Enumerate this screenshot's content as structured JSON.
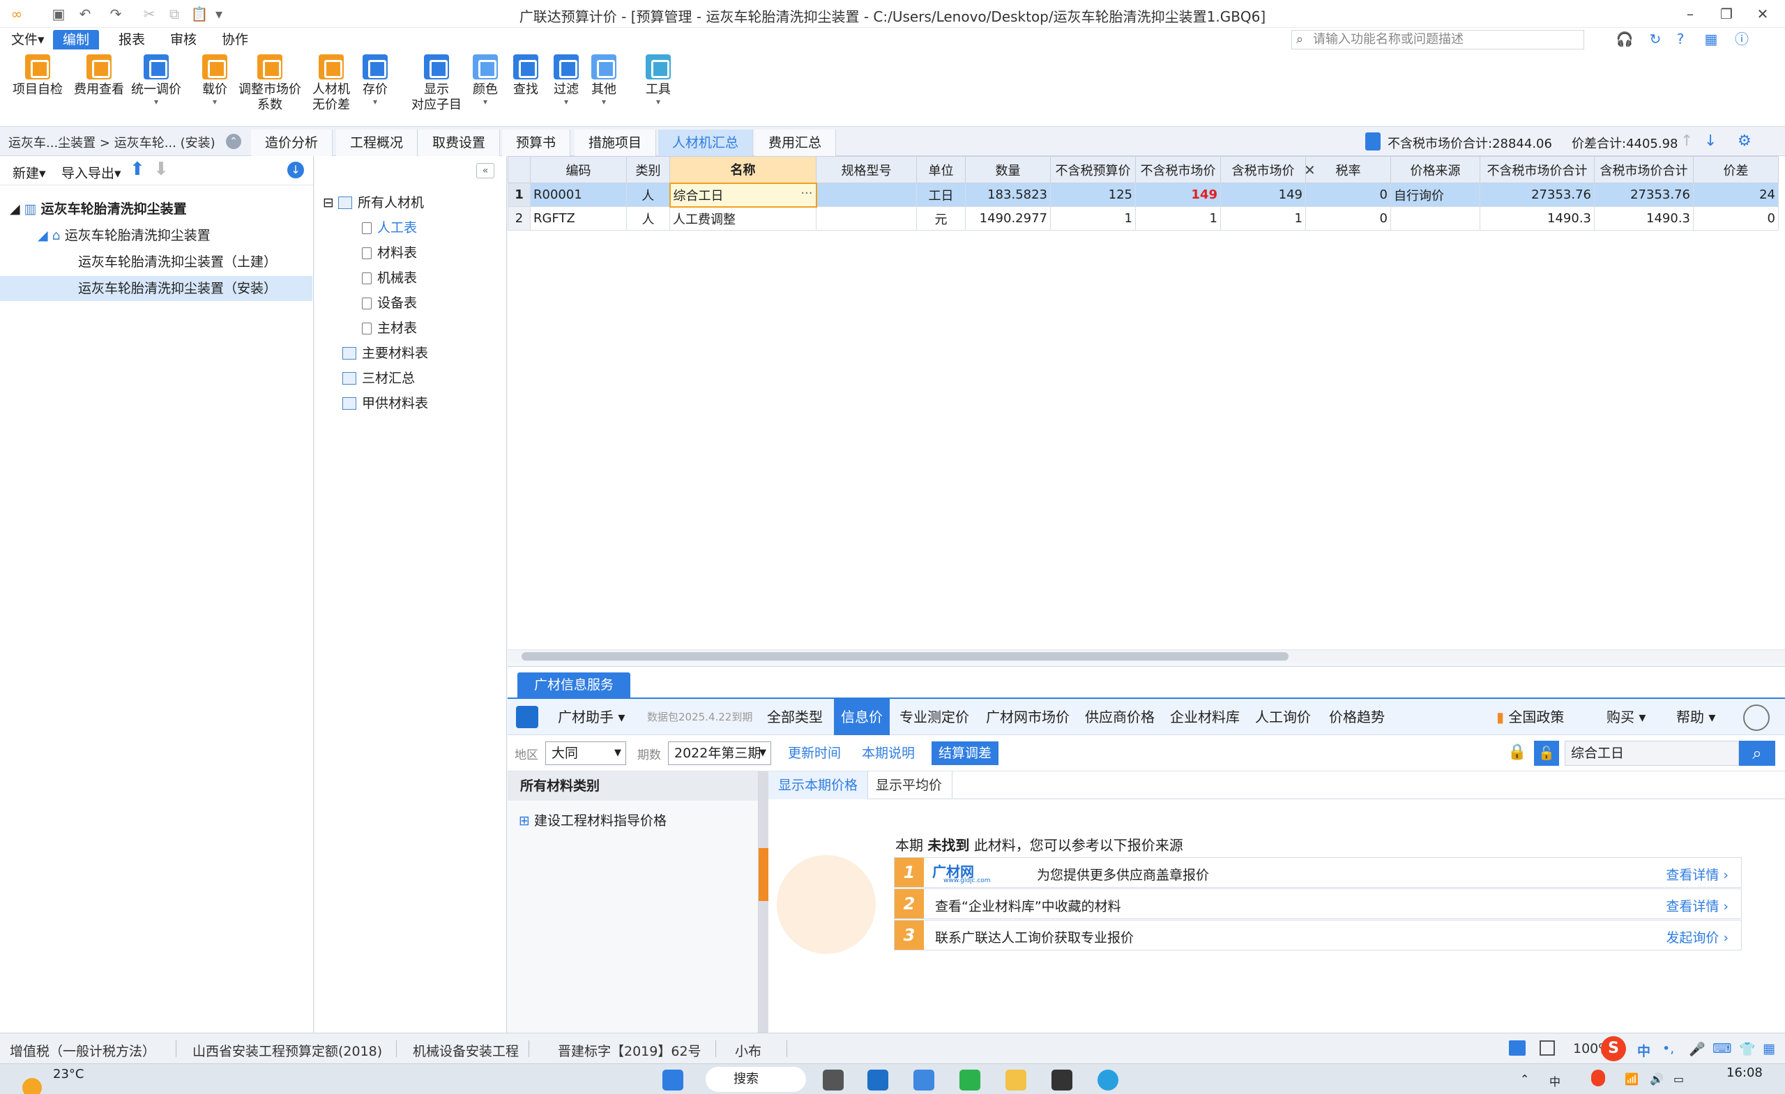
{
  "window": {
    "title": "广联达预算计价 - [预算管理 - 运灰车轮胎清洗抑尘装置 - C:/Users/Lenovo/Desktop/运灰车轮胎清洗抑尘装置1.GBQ6]",
    "minimize": "–",
    "restore": "❐",
    "close": "✕"
  },
  "menu": {
    "file": "文件",
    "edit": "编制",
    "report": "报表",
    "review": "审核",
    "collab": "协作",
    "search_placeholder": "请输入功能名称或问题描述"
  },
  "ribbon": {
    "b1": "项目自检",
    "b2": "费用查看",
    "b3": "统一调价",
    "b4": "载价",
    "b5a": "调整市场价",
    "b5b": "系数",
    "b6a": "人材机",
    "b6b": "无价差",
    "b7": "存价",
    "b8a": "显示",
    "b8b": "对应子目",
    "b9": "颜色",
    "b10": "查找",
    "b11": "过滤",
    "b12": "其他",
    "b13": "工具"
  },
  "tabs": {
    "breadcrumb": "运灰车...尘装置 > 运灰车轮... (安装)",
    "t1": "造价分析",
    "t2": "工程概况",
    "t3": "取费设置",
    "t4": "预算书",
    "t5": "措施项目",
    "t6": "人材机汇总",
    "t7": "费用汇总",
    "sum_market_label": "不含税市场价合计:",
    "sum_market_value": "28844.06",
    "sum_diff_label": "价差合计:",
    "sum_diff_value": "4405.98"
  },
  "left": {
    "new": "新建",
    "import": "导入导出",
    "root": "运灰车轮胎清洗抑尘装置",
    "child": "运灰车轮胎清洗抑尘装置",
    "leaf1": "运灰车轮胎清洗抑尘装置（土建）",
    "leaf2": "运灰车轮胎清洗抑尘装置（安装）"
  },
  "categories": {
    "all": "所有人材机",
    "labor": "人工表",
    "material": "材料表",
    "machine": "机械表",
    "equipment": "设备表",
    "main": "主材表",
    "major": "主要材料表",
    "three": "三材汇总",
    "supplied": "甲供材料表"
  },
  "grid": {
    "headers": {
      "code": "编码",
      "type": "类别",
      "name": "名称",
      "spec": "规格型号",
      "unit": "单位",
      "qty": "数量",
      "budget": "不含税预算价",
      "market": "不含税市场价",
      "taxmarket": "含税市场价",
      "rate": "税率",
      "source": "价格来源",
      "sum": "不含税市场价合计",
      "taxsum": "含税市场价合计",
      "diff": "价差"
    },
    "rows": [
      {
        "no": "1",
        "code": "R00001",
        "type": "人",
        "name": "综合工日",
        "spec": "",
        "unit": "工日",
        "qty": "183.5823",
        "budget": "125",
        "market": "149",
        "taxmarket": "149",
        "rate": "0",
        "source": "自行询价",
        "sum": "27353.76",
        "taxsum": "27353.76",
        "diff": "24"
      },
      {
        "no": "2",
        "code": "RGFTZ",
        "type": "人",
        "name": "人工费调整",
        "spec": "",
        "unit": "元",
        "qty": "1490.2977",
        "budget": "1",
        "market": "1",
        "taxmarket": "1",
        "rate": "0",
        "source": "",
        "sum": "1490.3",
        "taxsum": "1490.3",
        "diff": "0"
      }
    ]
  },
  "info": {
    "tab": "广材信息服务",
    "assistant": "广材助手",
    "pkg": "数据包2025.4.22到期",
    "nav": [
      "全部类型",
      "信息价",
      "专业测定价",
      "广材网市场价",
      "供应商价格",
      "企业材料库",
      "人工询价",
      "价格趋势"
    ],
    "policy": "全国政策",
    "buy": "购买",
    "help": "帮助",
    "region_label": "地区",
    "region": "大同",
    "period_label": "期数",
    "period": "2022年第三期",
    "update_time": "更新时间",
    "period_note": "本期说明",
    "settle": "结算调差",
    "search_value": "综合工日",
    "cat_head": "所有材料类别",
    "cat_item": "建设工程材料指导价格",
    "ptab1": "显示本期价格",
    "ptab2": "显示平均价",
    "notfound_pre": "本期",
    "notfound_bold": "未找到",
    "notfound_post": "此材料，您可以参考以下报价来源",
    "src1_logo": "广材网",
    "src1_sub": "www.gldjc.com",
    "src1": "为您提供更多供应商盖章报价",
    "src2": "查看“企业材料库”中收藏的材料",
    "src3": "联系广联达人工询价获取专业报价",
    "detail": "查看详情 ›",
    "inquire": "发起询价 ›"
  },
  "status": {
    "s1": "增值税（一般计税方法）",
    "s2": "山西省安装工程预算定额(2018)",
    "s3": "机械设备安装工程",
    "s4": "晋建标字【2019】62号",
    "s5": "小布",
    "zoom": "100%",
    "ime": "中"
  },
  "taskbar": {
    "weather": "23°C",
    "search": "搜索",
    "time": "16:08"
  }
}
